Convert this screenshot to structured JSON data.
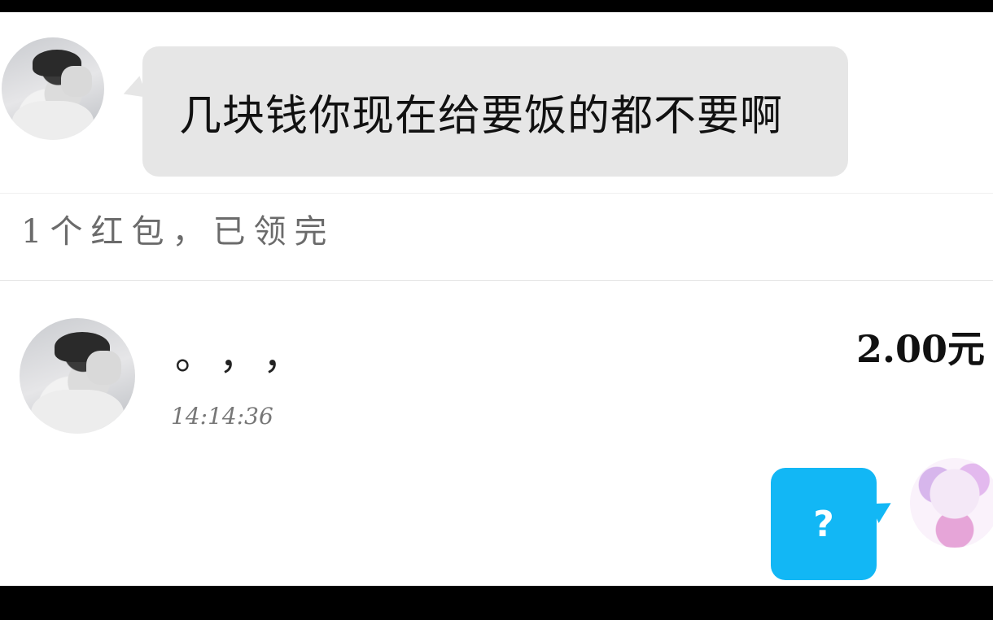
{
  "messages": {
    "received_text": "几块钱你现在给要饭的都不要啊",
    "red_packet": {
      "status": "1个红包，已领完"
    },
    "transfer": {
      "note": "。，，",
      "time": "14:14:36",
      "amount": "2.00元"
    },
    "sent_text": "?"
  },
  "colors": {
    "received_bubble": "#e6e6e6",
    "sent_bubble": "#12b7f5",
    "background": "#ffffff",
    "letterbox": "#000000"
  },
  "icons": {
    "contact_avatar": "male-photo-avatar",
    "self_avatar": "anime-avatar"
  }
}
